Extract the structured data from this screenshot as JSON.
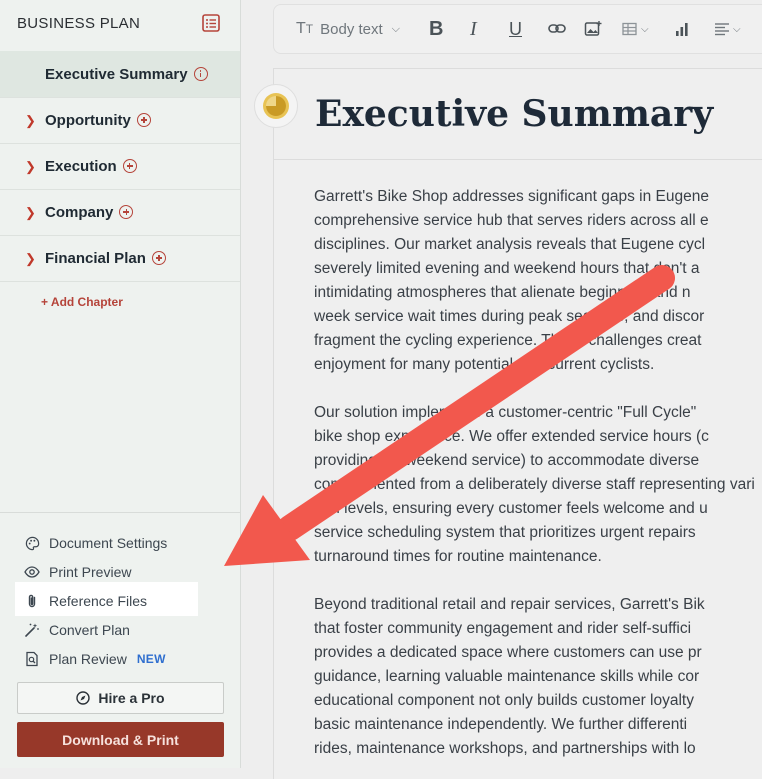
{
  "sidebar": {
    "title": "BUSINESS PLAN",
    "nav": [
      {
        "label": "Executive Summary"
      },
      {
        "label": "Opportunity"
      },
      {
        "label": "Execution"
      },
      {
        "label": "Company"
      },
      {
        "label": "Financial Plan"
      }
    ],
    "add_chapter": "+ Add Chapter",
    "tools": {
      "document_settings": "Document Settings",
      "print_preview": "Print Preview",
      "reference_files": "Reference Files",
      "convert_plan": "Convert Plan",
      "plan_review": "Plan Review",
      "new_badge": "NEW"
    },
    "hire_button": "Hire a Pro",
    "download_button": "Download & Print"
  },
  "toolbar": {
    "text_style": "Body text"
  },
  "document": {
    "title": "Executive Summary",
    "paragraphs": [
      [
        "Garrett's Bike Shop addresses significant gaps in Eugene",
        "comprehensive service hub that serves riders across all e",
        "disciplines. Our market analysis reveals that Eugene cycl",
        "severely limited evening and weekend hours that don't a",
        "intimidating atmospheres that alienate beginners and n",
        "week service wait times during peak seasons, and discor",
        "fragment the cycling experience. These challenges creat",
        "enjoyment for many potential and current cyclists."
      ],
      [
        "Our solution implements a customer-centric \"Full Cycle\"",
        "bike shop experience. We offer extended service hours (c",
        "providing full weekend service) to accommodate diverse",
        "complemented from a deliberately diverse staff representing vari",
        "skill levels, ensuring every customer feels welcome and u",
        "service scheduling system that prioritizes urgent repairs",
        "turnaround times for routine maintenance."
      ],
      [
        "Beyond traditional retail and repair services, Garrett's Bik",
        "that foster community engagement and rider self-suffici",
        "provides a dedicated space where customers can use pr",
        "guidance, learning valuable maintenance skills while cor",
        "educational component not only builds customer loyalty",
        "basic maintenance independently. We further differenti",
        "rides, maintenance workshops, and partnerships with lo"
      ]
    ]
  },
  "colors": {
    "accent": "#b5443a",
    "download_bg": "#973829",
    "arrow": "#f2584d",
    "new_badge": "#2f6fcf"
  }
}
